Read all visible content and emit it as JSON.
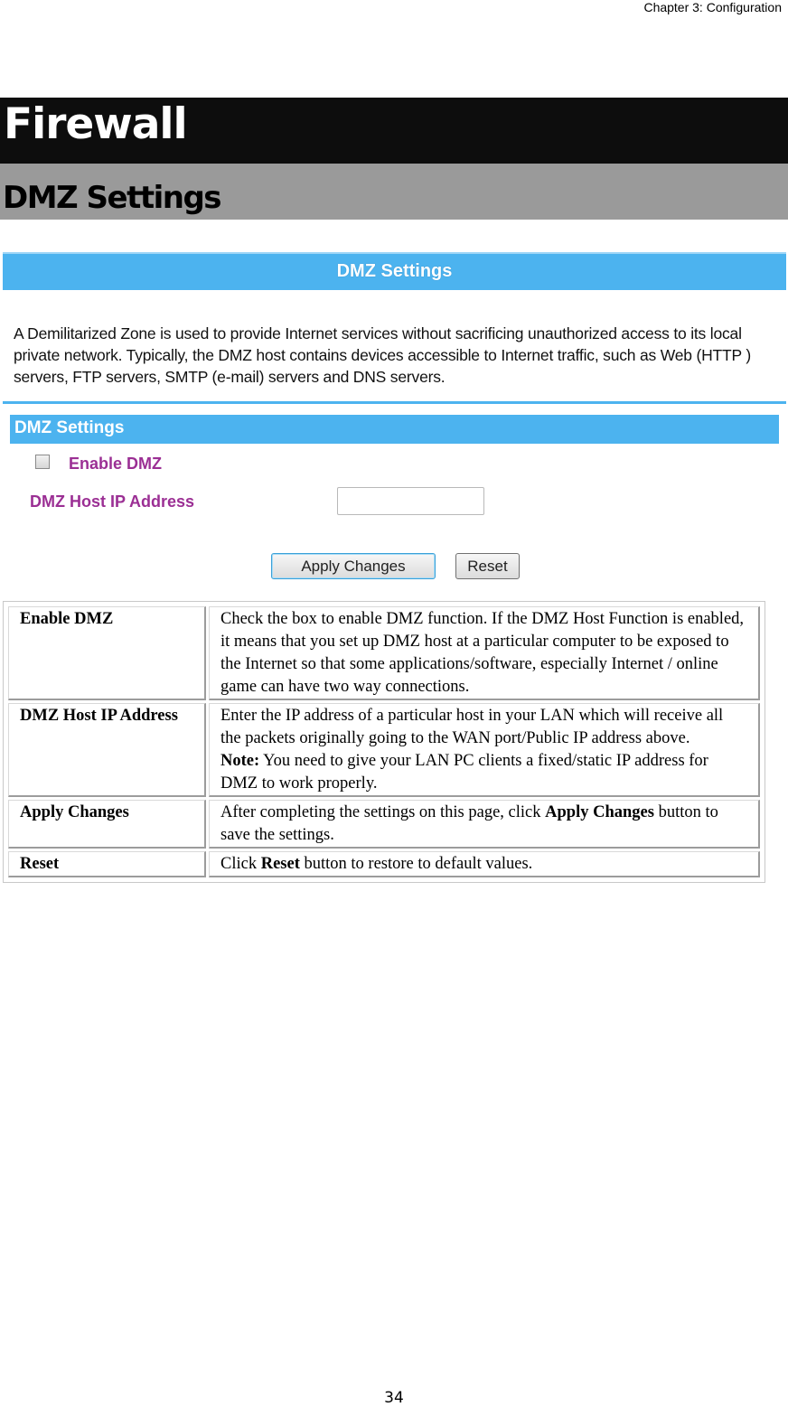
{
  "running_header": "Chapter 3: Configuration",
  "heading1": "Firewall",
  "heading2": "DMZ Settings",
  "screenshot": {
    "title": "DMZ Settings",
    "description": "A Demilitarized Zone is used to provide Internet services without sacrificing unauthorized access to its local private network. Typically, the DMZ host contains devices accessible to Internet traffic, such as Web (HTTP ) servers, FTP servers, SMTP (e-mail) servers and DNS servers.",
    "section_title": "DMZ Settings",
    "enable_dmz": {
      "label": "Enable DMZ",
      "checked": false
    },
    "host_ip": {
      "label": "DMZ Host IP Address",
      "value": ""
    },
    "apply_button": "Apply Changes",
    "reset_button": "Reset",
    "colors": {
      "bar": "#4cb3ef",
      "label": "#9b2f94"
    }
  },
  "table": {
    "rows": [
      {
        "term": "Enable DMZ",
        "desc": [
          {
            "text": "Check the box to enable DMZ function. If the DMZ Host Function is enabled, it means that you set up DMZ host at a particular computer to be exposed to the Internet so that some applications/software, especially Internet / online game can have two way connections."
          }
        ]
      },
      {
        "term": "DMZ Host IP Address",
        "desc": [
          {
            "text": "Enter the IP address of a particular host in your LAN which will receive all the packets originally going to the WAN port/Public IP address above."
          },
          {
            "bold": "Note:",
            "text": " You need to give your LAN PC clients a fixed/static IP address for DMZ to work properly."
          }
        ]
      },
      {
        "term": "Apply Changes",
        "desc": [
          {
            "pre": "After completing the settings on this page, click ",
            "bold": "Apply Changes",
            "text": " button to save the settings."
          }
        ]
      },
      {
        "term": "Reset",
        "desc": [
          {
            "pre": "Click ",
            "bold": "Reset",
            "text": " button to restore to default values."
          }
        ]
      }
    ]
  },
  "page_number": "34"
}
